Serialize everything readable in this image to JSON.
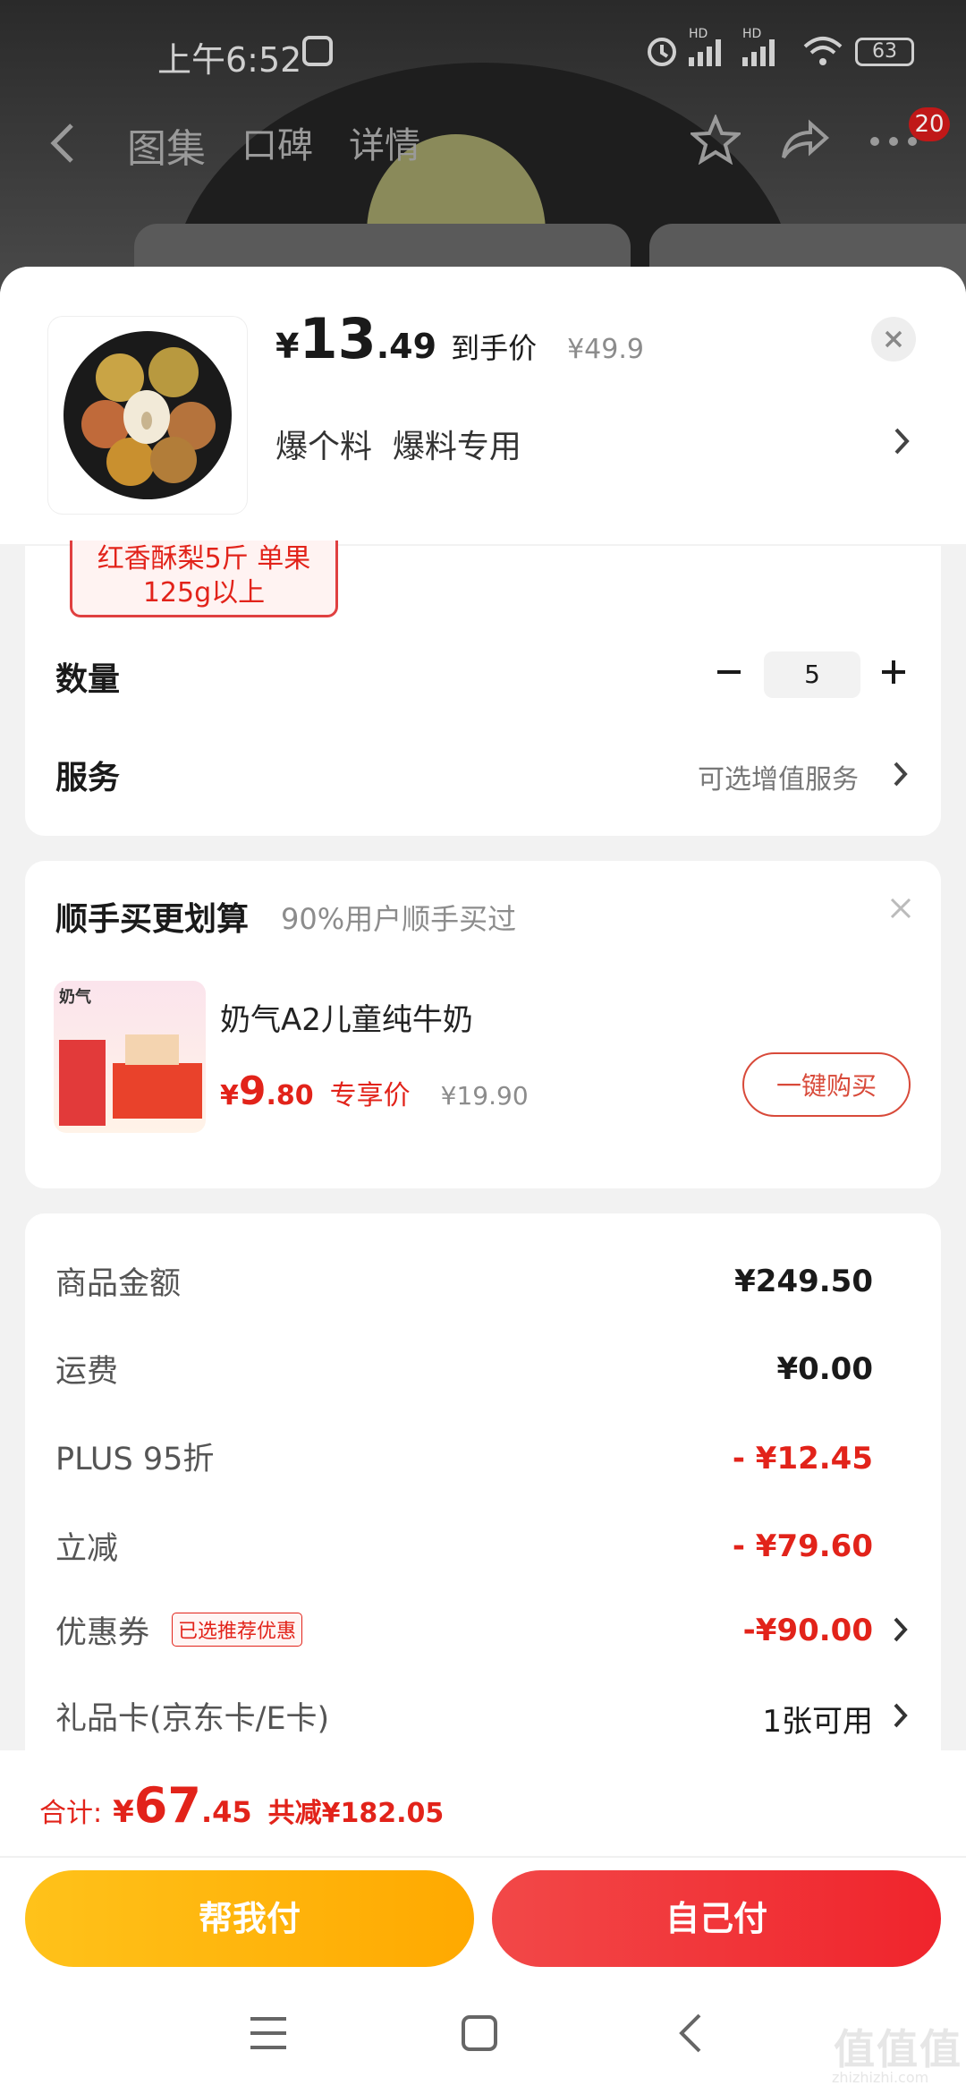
{
  "status_bar": {
    "time": "上午6:52",
    "battery": "63",
    "signal1_label": "HD",
    "signal2_label": "HD"
  },
  "nav": {
    "tabs": [
      "图集",
      "口碑",
      "详情"
    ],
    "cart_badge": "20"
  },
  "product": {
    "price_symbol": "¥",
    "price_int": "13",
    "price_dec": ".49",
    "price_label": "到手价",
    "original_price": "¥49.9",
    "selected_spec": "爆个料  爆料专用",
    "spec_chip": "红香酥梨5斤 单果125g以上",
    "quantity_label": "数量",
    "quantity": "5",
    "service_label": "服务",
    "service_hint": "可选增值服务"
  },
  "addon": {
    "title": "顺手买更划算",
    "subtitle": "90%用户顺手买过",
    "item_name": "奶气A2儿童纯牛奶",
    "price_symbol": "¥",
    "price_int": "9",
    "price_dec": ".80",
    "price_label": "专享价",
    "original_price": "¥19.90",
    "buy_button": "一键购买",
    "thumb_brand": "奶气"
  },
  "summary": {
    "rows": [
      {
        "label": "商品金额",
        "value": "¥249.50"
      },
      {
        "label": "运费",
        "value": "¥0.00"
      },
      {
        "label": "PLUS 95折",
        "value": "- ¥12.45"
      },
      {
        "label": "立减",
        "value": "- ¥79.60"
      },
      {
        "label": "优惠券",
        "tag": "已选推荐优惠",
        "value": "-¥90.00"
      },
      {
        "label": "礼品卡(京东卡/E卡)",
        "value": "1张可用"
      }
    ]
  },
  "footer": {
    "total_label": "合计:",
    "total_symbol": "¥",
    "total_int": "67",
    "total_dec": ".45",
    "savings": "共减¥182.05",
    "help_pay": "帮我付",
    "self_pay": "自己付"
  },
  "watermark": {
    "text": "值值值",
    "url": "zhizhizhi.com"
  },
  "colors": {
    "accent_red": "#e2231a",
    "button_yellow": "#ffb400",
    "button_red": "#f23030"
  }
}
